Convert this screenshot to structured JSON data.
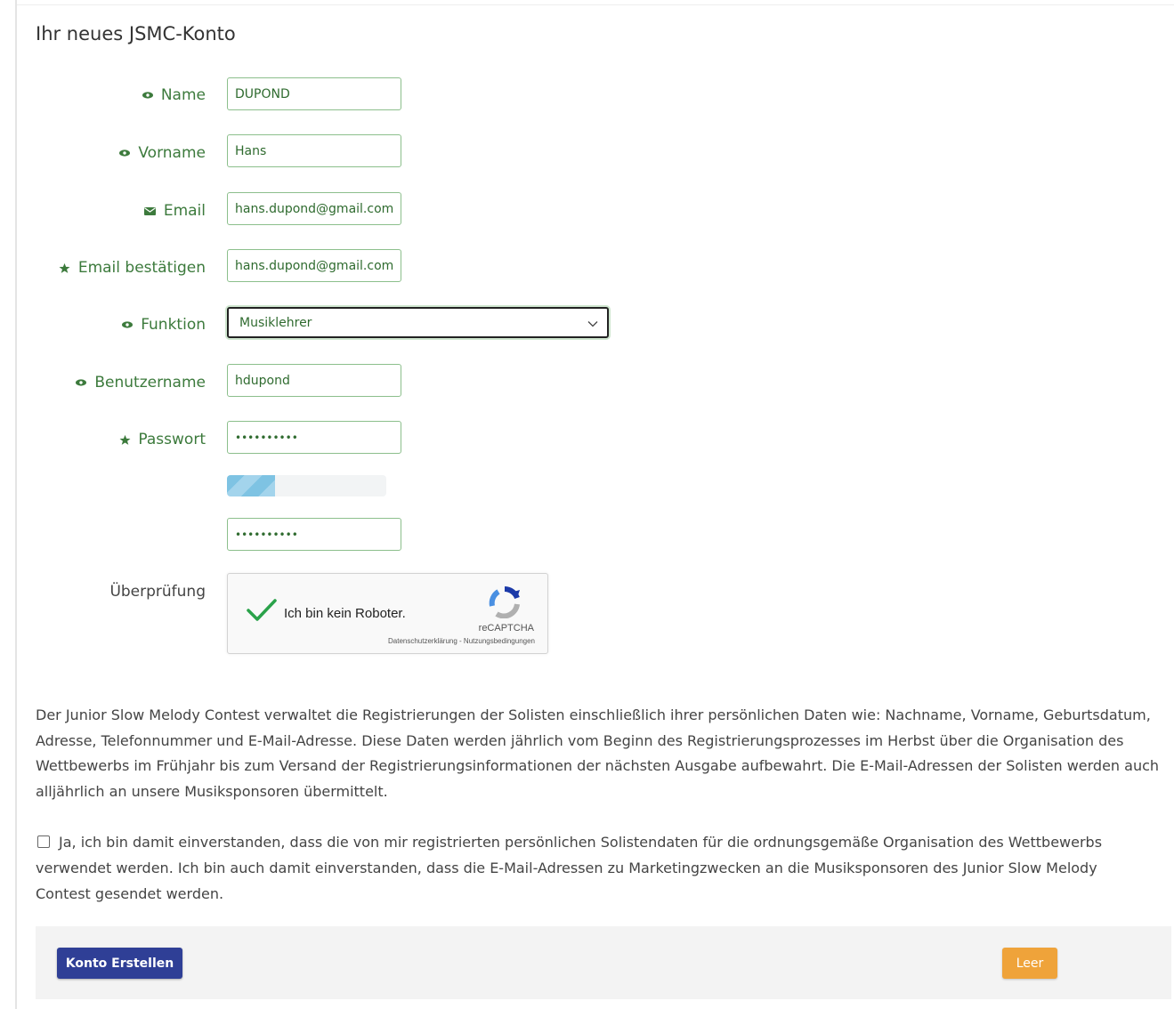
{
  "page": {
    "title": "Ihr neues JSMC-Konto"
  },
  "colors": {
    "label_green": "#3c7a3c",
    "input_border": "#8cbf8c",
    "primary_button": "#2f3f96",
    "warning_button": "#efa33a",
    "strength_fill": "#7ec3e3"
  },
  "form": {
    "name": {
      "label": "Name",
      "icon": "eye-icon",
      "value": "DUPOND"
    },
    "vorname": {
      "label": "Vorname",
      "icon": "eye-icon",
      "value": "Hans"
    },
    "email": {
      "label": "Email",
      "icon": "envelope-icon",
      "value": "hans.dupond@gmail.com"
    },
    "email_confirm": {
      "label": "Email bestätigen",
      "icon": "star-icon",
      "value": "hans.dupond@gmail.com"
    },
    "funktion": {
      "label": "Funktion",
      "icon": "eye-icon",
      "selected": "Musiklehrer"
    },
    "benutzername": {
      "label": "Benutzername",
      "icon": "eye-icon",
      "value": "hdupond"
    },
    "passwort": {
      "label": "Passwort",
      "icon": "star-icon",
      "value": "••••••••••",
      "strength": 0.3
    },
    "passwort_confirm": {
      "value": "••••••••••"
    },
    "verification": {
      "label": "Überprüfung",
      "captcha_text": "Ich bin kein Roboter.",
      "captcha_brand": "reCAPTCHA",
      "captcha_links": "Datenschutzerklärung - Nutzungsbedingungen"
    }
  },
  "privacy": {
    "text": "Der Junior Slow Melody Contest verwaltet die Registrierungen der Solisten einschließlich ihrer persönlichen Daten wie: Nachname, Vorname, Geburtsdatum, Adresse, Telefonnummer und E-Mail-Adresse. Diese Daten werden jährlich vom Beginn des Registrierungsprozesses im Herbst über die Organisation des Wettbewerbs im Frühjahr bis zum Versand der Registrierungsinformationen der nächsten Ausgabe aufbewahrt. Die E-Mail-Adressen der Solisten werden auch alljährlich an unsere Musiksponsoren übermittelt."
  },
  "consent": {
    "checked": false,
    "text": "Ja, ich bin damit einverstanden, dass die von mir registrierten persönlichen Solistendaten für die ordnungsgemäße Organisation des Wettbewerbs verwendet werden. Ich bin auch damit einverstanden, dass die E-Mail-Adressen zu Marketingzwecken an die Musiksponsoren des Junior Slow Melody Contest gesendet werden."
  },
  "footer": {
    "submit_label": "Konto Erstellen",
    "reset_label": "Leer"
  }
}
